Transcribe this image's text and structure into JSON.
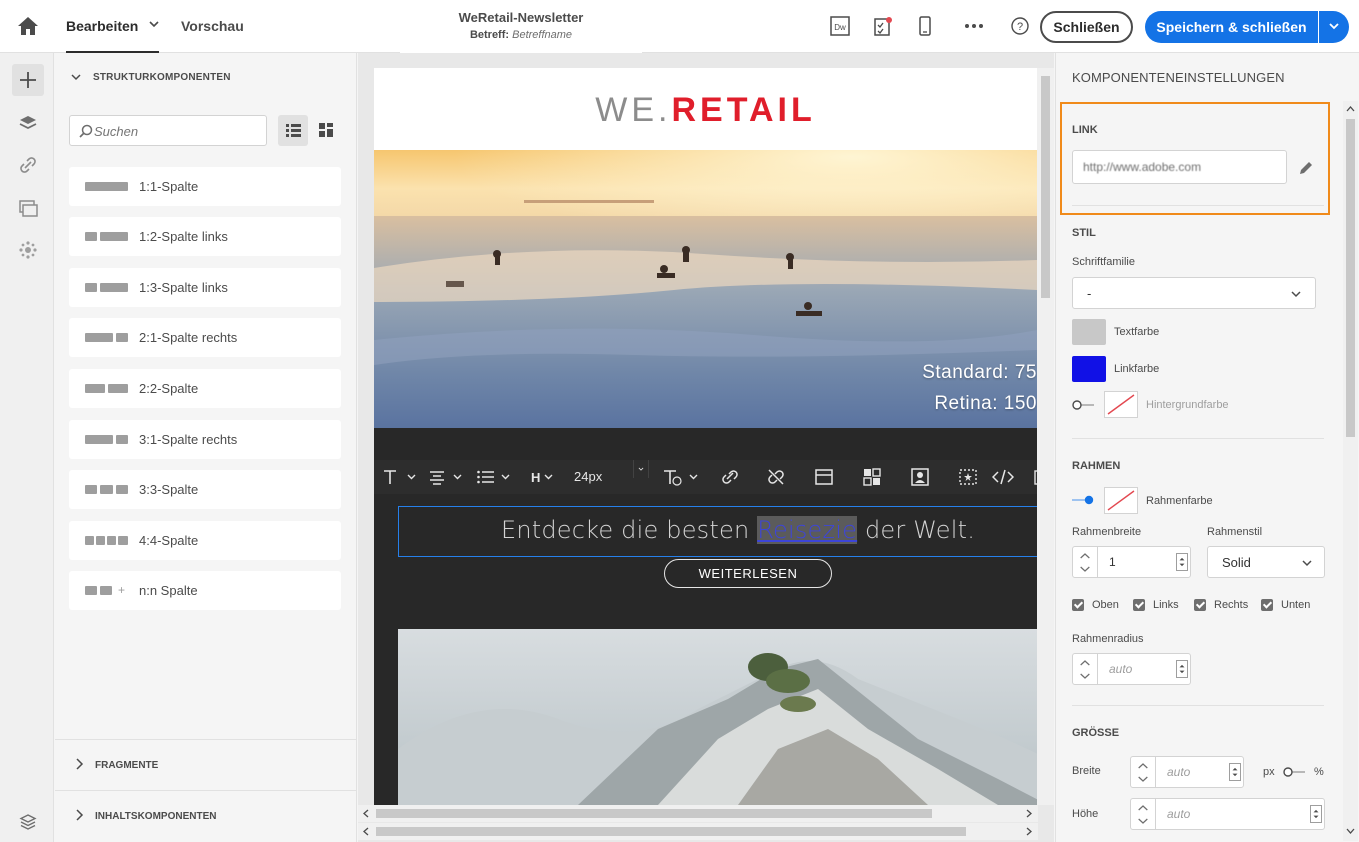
{
  "header": {
    "tab_edit": "Bearbeiten",
    "tab_preview": "Vorschau",
    "doc_title": "WeRetail-Newsletter",
    "subject_label": "Betreff:",
    "subject_value": "Betreffname",
    "close_label": "Schließen",
    "save_label": "Speichern & schließen"
  },
  "left_panel": {
    "section_title": "STRUKTURKOMPONENTEN",
    "search_placeholder": "Suchen",
    "components": [
      {
        "label": "1:1-Spalte"
      },
      {
        "label": "1:2-Spalte links"
      },
      {
        "label": "1:3-Spalte links"
      },
      {
        "label": "2:1-Spalte rechts"
      },
      {
        "label": "2:2-Spalte"
      },
      {
        "label": "3:1-Spalte rechts"
      },
      {
        "label": "3:3-Spalte"
      },
      {
        "label": "4:4-Spalte"
      },
      {
        "label": "n:n Spalte"
      }
    ],
    "fragments": "FRAGMENTE",
    "content_components": "INHALTSKOMPONENTEN"
  },
  "email": {
    "logo_left": "WE.",
    "logo_right": "RETAIL",
    "hero_caption_1": "Standard: 75",
    "hero_caption_2": "Retina: 150",
    "toolbar_font_size": "24px",
    "headline_before": "Entdecke die besten ",
    "headline_link": "Reisezie",
    "headline_after": " der Welt.",
    "read_more": "WEITERLESEN"
  },
  "right_panel": {
    "title": "KOMPONENTENEINSTELLUNGEN",
    "link_section": "LINK",
    "link_value": "http://www.adobe.com",
    "style_section": "STIL",
    "font_family_label": "Schriftfamilie",
    "font_family_value": "-",
    "text_color_label": "Textfarbe",
    "link_color_label": "Linkfarbe",
    "bg_color_label": "Hintergrundfarbe",
    "border_section": "RAHMEN",
    "border_color_label": "Rahmenfarbe",
    "border_width_label": "Rahmenbreite",
    "border_width_value": "1",
    "border_style_label": "Rahmenstil",
    "border_style_value": "Solid",
    "sides": [
      "Oben",
      "Links",
      "Rechts",
      "Unten"
    ],
    "border_radius_label": "Rahmenradius",
    "border_radius_placeholder": "auto",
    "size_section": "GRÖSSE",
    "width_label": "Breite",
    "width_placeholder": "auto",
    "unit_px": "px",
    "unit_pct": "%",
    "height_label": "Höhe",
    "height_placeholder": "auto"
  },
  "colors": {
    "accent_blue": "#1473e6",
    "highlight_orange": "#f08a1a",
    "text_swatch": "#c8c8c8",
    "link_swatch": "#1111e6",
    "brand_red": "#e01e2b"
  }
}
